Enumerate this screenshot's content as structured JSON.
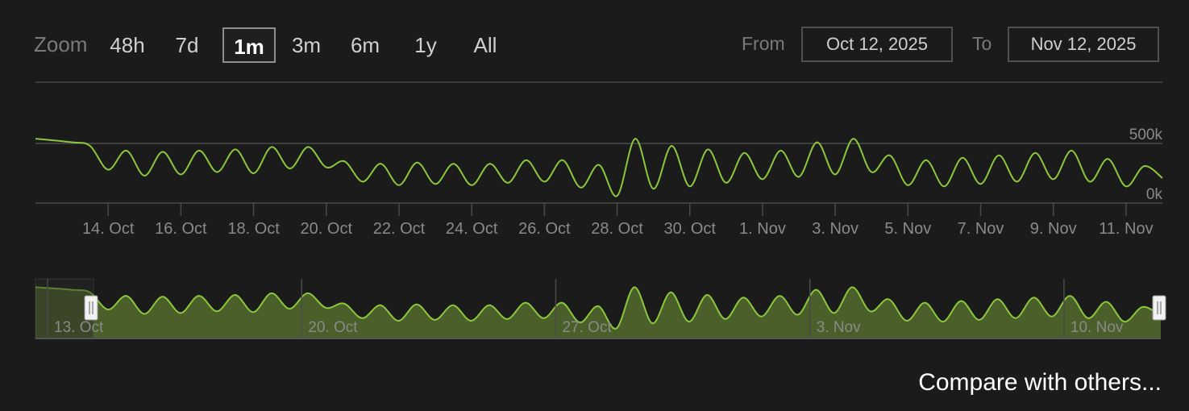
{
  "zoom": {
    "label": "Zoom",
    "options": [
      "48h",
      "7d",
      "1m",
      "3m",
      "6m",
      "1y",
      "All"
    ],
    "selected": "1m"
  },
  "range": {
    "from_label": "From",
    "from_value": "Oct 12, 2025",
    "to_label": "To",
    "to_value": "Nov 12, 2025"
  },
  "compare_label": "Compare with others...",
  "colors": {
    "line": "#8cc83c",
    "navigator_fill": "#4a5f29",
    "grid": "#4a4a4a",
    "text": "#8a8a8a"
  },
  "chart_data": {
    "type": "line",
    "title": "",
    "xlabel": "",
    "ylabel": "",
    "ylim": [
      0,
      500000
    ],
    "y_tick_labels": [
      "500k",
      "0k"
    ],
    "grid": true,
    "x_range": [
      "2025-10-12",
      "2025-11-12"
    ],
    "x_tick_labels": [
      "14. Oct",
      "16. Oct",
      "18. Oct",
      "20. Oct",
      "22. Oct",
      "24. Oct",
      "26. Oct",
      "28. Oct",
      "30. Oct",
      "1. Nov",
      "3. Nov",
      "5. Nov",
      "7. Nov",
      "9. Nov",
      "11. Nov"
    ],
    "x_tick_dates": [
      "2025-10-14",
      "2025-10-16",
      "2025-10-18",
      "2025-10-20",
      "2025-10-22",
      "2025-10-24",
      "2025-10-26",
      "2025-10-28",
      "2025-10-30",
      "2025-11-01",
      "2025-11-03",
      "2025-11-05",
      "2025-11-07",
      "2025-11-09",
      "2025-11-11"
    ],
    "series": [
      {
        "values_approx": true,
        "x": [
          "2025-10-12",
          "2025-10-13",
          "2025-10-13 12:00",
          "2025-10-14",
          "2025-10-14 12:00",
          "2025-10-15",
          "2025-10-15 12:00",
          "2025-10-16",
          "2025-10-16 12:00",
          "2025-10-17",
          "2025-10-17 12:00",
          "2025-10-18",
          "2025-10-18 12:00",
          "2025-10-19",
          "2025-10-19 12:00",
          "2025-10-20",
          "2025-10-20 12:00",
          "2025-10-21",
          "2025-10-21 12:00",
          "2025-10-22",
          "2025-10-22 12:00",
          "2025-10-23",
          "2025-10-23 12:00",
          "2025-10-24",
          "2025-10-24 12:00",
          "2025-10-25",
          "2025-10-25 12:00",
          "2025-10-26",
          "2025-10-26 12:00",
          "2025-10-27",
          "2025-10-27 12:00",
          "2025-10-28",
          "2025-10-28 12:00",
          "2025-10-29",
          "2025-10-29 12:00",
          "2025-10-30",
          "2025-10-30 12:00",
          "2025-10-31",
          "2025-10-31 12:00",
          "2025-11-01",
          "2025-11-01 12:00",
          "2025-11-02",
          "2025-11-02 12:00",
          "2025-11-03",
          "2025-11-03 12:00",
          "2025-11-04",
          "2025-11-04 12:00",
          "2025-11-05",
          "2025-11-05 12:00",
          "2025-11-06",
          "2025-11-06 12:00",
          "2025-11-07",
          "2025-11-07 12:00",
          "2025-11-08",
          "2025-11-08 12:00",
          "2025-11-09",
          "2025-11-09 12:00",
          "2025-11-10",
          "2025-11-10 12:00",
          "2025-11-11",
          "2025-11-11 12:00",
          "2025-11-12"
        ],
        "values": [
          540000,
          510000,
          480000,
          280000,
          440000,
          230000,
          430000,
          240000,
          440000,
          260000,
          450000,
          250000,
          470000,
          290000,
          470000,
          300000,
          350000,
          180000,
          330000,
          150000,
          340000,
          160000,
          330000,
          150000,
          330000,
          170000,
          360000,
          180000,
          360000,
          130000,
          320000,
          60000,
          540000,
          120000,
          480000,
          140000,
          450000,
          170000,
          420000,
          200000,
          440000,
          220000,
          510000,
          240000,
          540000,
          260000,
          400000,
          150000,
          360000,
          140000,
          380000,
          160000,
          400000,
          180000,
          420000,
          200000,
          440000,
          180000,
          370000,
          140000,
          310000,
          210000
        ]
      }
    ],
    "navigator": {
      "x_tick_labels": [
        "13. Oct",
        "20. Oct",
        "27. Oct",
        "3. Nov",
        "10. Nov"
      ],
      "x_tick_dates": [
        "2025-10-13",
        "2025-10-20",
        "2025-10-27",
        "2025-11-03",
        "2025-11-10"
      ],
      "selected_range": [
        "2025-10-12",
        "2025-11-12"
      ]
    }
  }
}
